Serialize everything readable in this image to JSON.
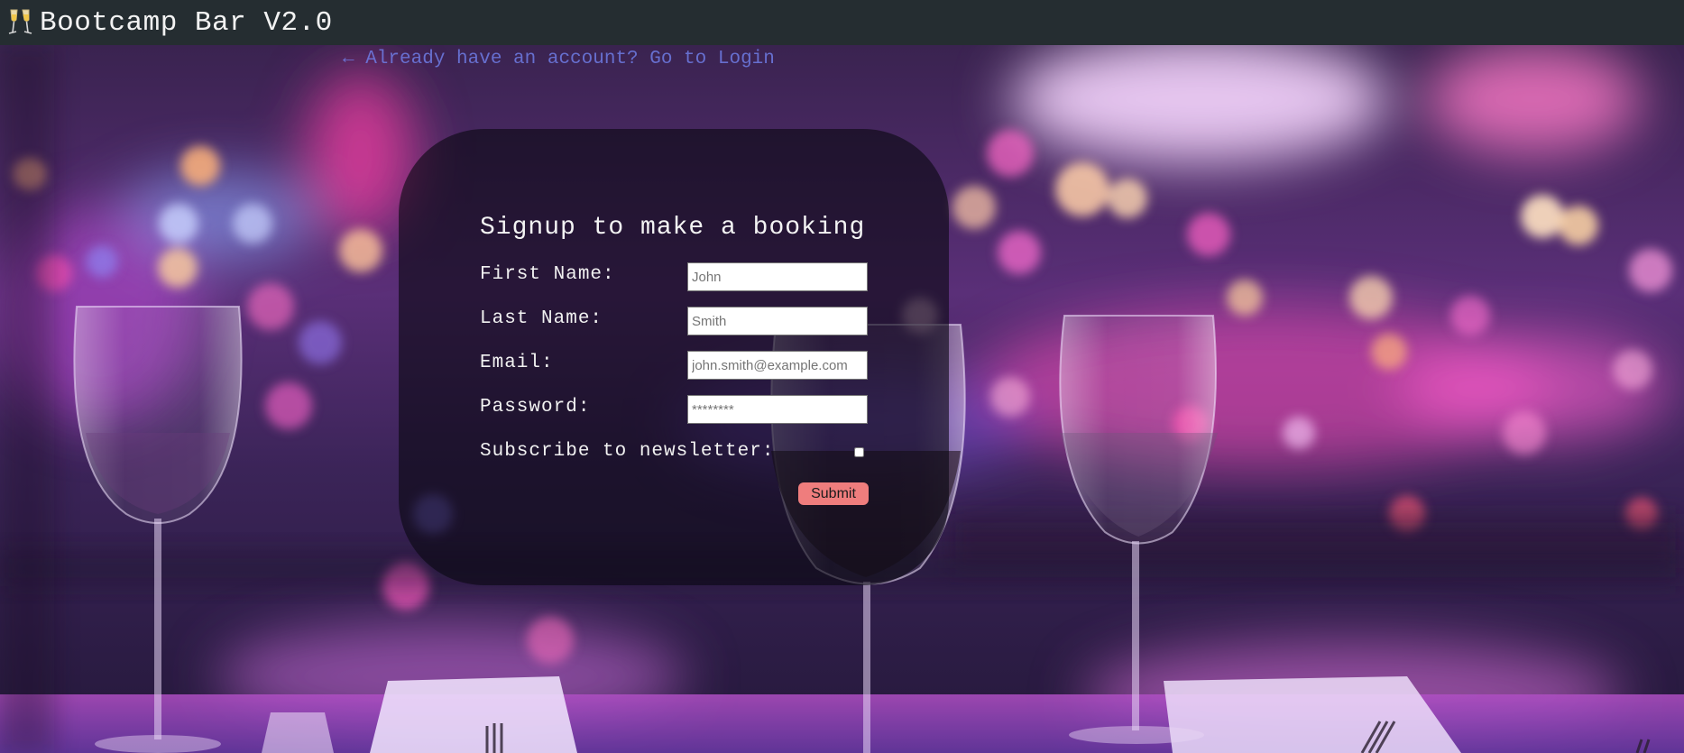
{
  "app": {
    "title": "Bootcamp Bar V2.0",
    "icon": "champagne-glasses-icon"
  },
  "nav": {
    "login_link": "← Already have an account? Go to Login"
  },
  "form": {
    "title": "Signup to make a booking",
    "first_name": {
      "label": "First Name:",
      "placeholder": "John",
      "value": ""
    },
    "last_name": {
      "label": "Last Name:",
      "placeholder": "Smith",
      "value": ""
    },
    "email": {
      "label": "Email:",
      "placeholder": "john.smith@example.com",
      "value": ""
    },
    "password": {
      "label": "Password:",
      "placeholder": "********",
      "value": ""
    },
    "newsletter": {
      "label": "Subscribe to newsletter:",
      "checked": false
    },
    "submit_label": "Submit"
  },
  "colors": {
    "navbar": "#252d31",
    "link": "#6f7de6",
    "submit": "#ef7d7d",
    "card": "rgba(10,8,18,0.62)"
  }
}
